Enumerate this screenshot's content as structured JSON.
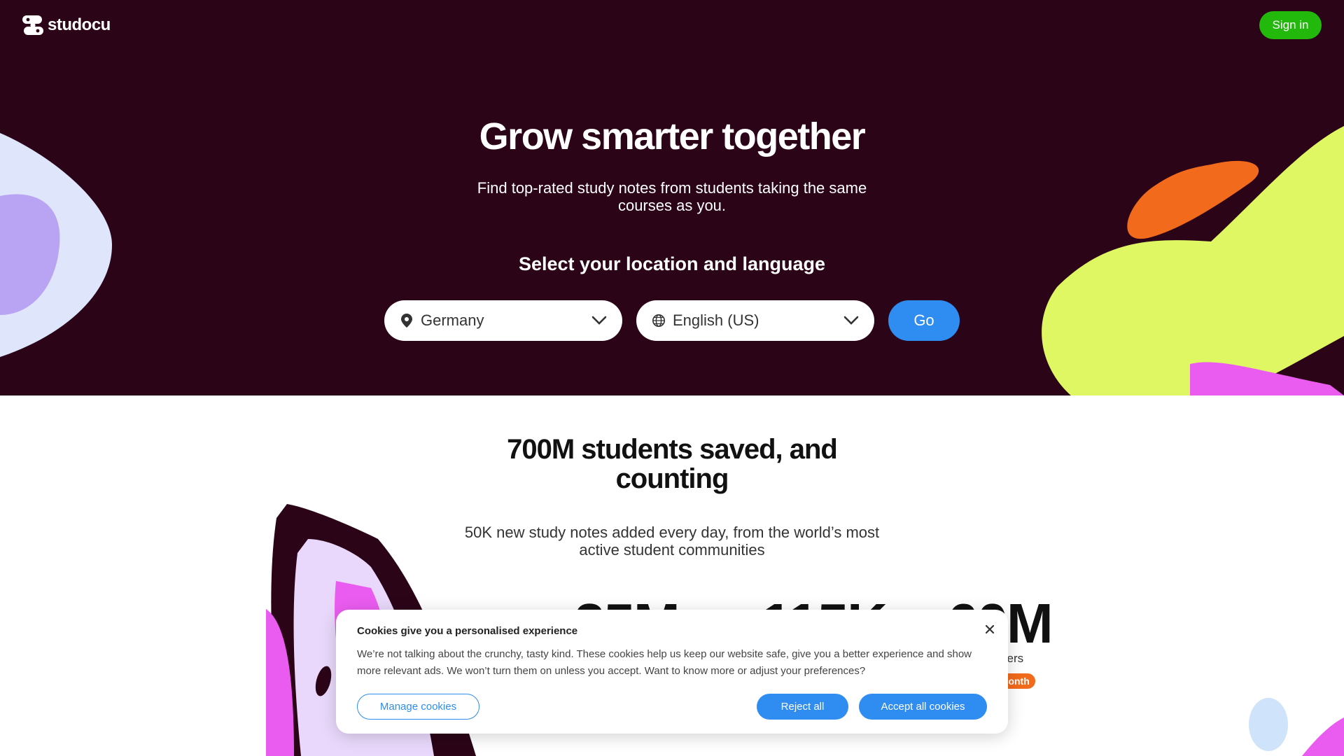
{
  "header": {
    "logo_text": "studocu",
    "sign_in_label": "Sign in"
  },
  "hero": {
    "title": "Grow smarter together",
    "subtitle": "Find top-rated study notes from students taking the same courses as you.",
    "select_heading": "Select your location and language",
    "location_value": "Germany",
    "language_value": "English (US)",
    "go_label": "Go"
  },
  "stats": {
    "title": "700M students saved, and counting",
    "subtitle": "50K new study notes added every day, from the world’s most active student communities",
    "numbers": [
      "25M",
      "115K",
      "60M"
    ],
    "label_partial": "sers",
    "badge_partial": "month"
  },
  "cookie": {
    "title": "Cookies give you a personalised experience",
    "text": "We’re not talking about the crunchy, tasty kind. These cookies help us keep our website safe, give you a better experience and show more relevant ads. We won’t turn them on unless you accept. Want to know more or adjust your preferences?",
    "manage_label": "Manage cookies",
    "reject_label": "Reject all",
    "accept_label": "Accept all cookies"
  },
  "colors": {
    "hero_bg": "#2b0418",
    "accent_blue": "#2f8cf0",
    "sign_in_green": "#22b80c",
    "badge_orange": "#f26a1b",
    "lime": "#def763",
    "magenta": "#ea5cf0",
    "lavender": "#b9a4f4"
  }
}
